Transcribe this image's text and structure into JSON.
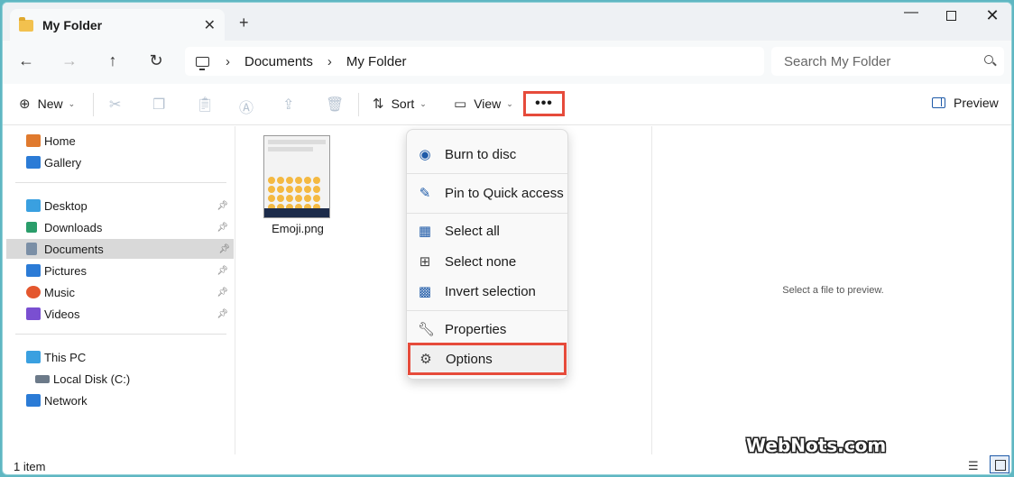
{
  "window": {
    "title": "My Folder",
    "close_tab": "✕",
    "new_tab": "+"
  },
  "window_controls": {
    "minimize": "—",
    "close": "✕"
  },
  "navigation": {
    "back": "←",
    "forward": "→",
    "up": "↑",
    "refresh": "↻",
    "breadcrumb": [
      "Documents",
      "My Folder"
    ],
    "separator": "›"
  },
  "search": {
    "placeholder": "Search My Folder"
  },
  "toolbar": {
    "new_label": "New",
    "sort_label": "Sort",
    "view_label": "View",
    "more_label": "•••",
    "preview_label": "Preview",
    "caret": "⌄"
  },
  "sidebar": {
    "items": [
      {
        "label": "Home",
        "color": "#e07a2e"
      },
      {
        "label": "Gallery",
        "color": "#2b7bd6"
      },
      {
        "label": "Desktop",
        "color": "#3aa0e0",
        "pinned": true
      },
      {
        "label": "Downloads",
        "color": "#2a9d6a",
        "pinned": true
      },
      {
        "label": "Documents",
        "color": "#7b8fa6",
        "pinned": true,
        "selected": true
      },
      {
        "label": "Pictures",
        "color": "#2b7bd6",
        "pinned": true
      },
      {
        "label": "Music",
        "color": "#e4572e",
        "pinned": true
      },
      {
        "label": "Videos",
        "color": "#7a4fd1",
        "pinned": true
      },
      {
        "label": "This PC",
        "color": "#3aa0e0"
      },
      {
        "label": "Local Disk (C:)",
        "color": "#6c7a89"
      },
      {
        "label": "Network",
        "color": "#2b7bd6"
      }
    ]
  },
  "files": [
    {
      "name": "Emoji.png"
    }
  ],
  "menu": {
    "items": [
      {
        "label": "Burn to disc",
        "icon": "disc-icon"
      },
      {
        "label": "Pin to Quick access",
        "icon": "pin-icon"
      },
      {
        "label": "Select all",
        "icon": "select-all-icon"
      },
      {
        "label": "Select none",
        "icon": "select-none-icon"
      },
      {
        "label": "Invert selection",
        "icon": "invert-selection-icon"
      },
      {
        "label": "Properties",
        "icon": "wrench-icon"
      },
      {
        "label": "Options",
        "icon": "gear-icon"
      }
    ]
  },
  "preview": {
    "message": "Select a file to preview."
  },
  "watermark": "WebNots.com",
  "status": {
    "item_count": "1 item"
  },
  "colors": {
    "accent": "#1e5aa8",
    "highlight": "#e64b3b"
  }
}
